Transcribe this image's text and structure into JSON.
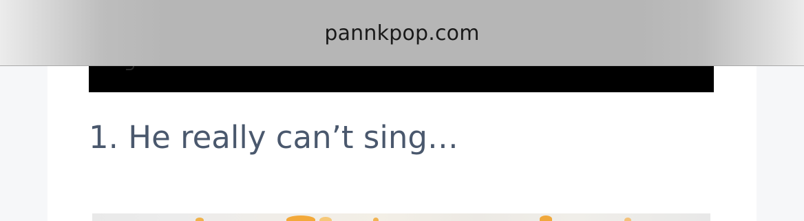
{
  "browser": {
    "url": "pannkpop.com"
  },
  "article": {
    "heading": "1. He really can’t sing…"
  }
}
